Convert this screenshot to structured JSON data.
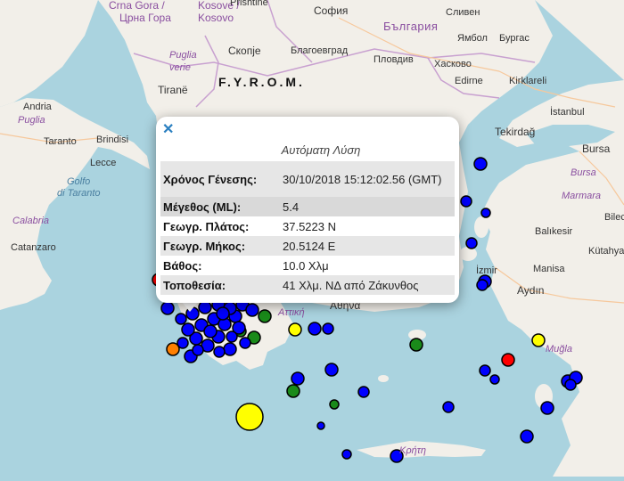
{
  "map_labels": {
    "crna_gora": "Crna Gora /",
    "crna_gora_cyr": "Црна Гора",
    "kosove": "Kosove /",
    "kosovo": "Kosovo",
    "sofia": "София",
    "bulgaria": "България",
    "sliven": "Сливен",
    "yambol": "Ямбол",
    "burgas": "Бургас",
    "pristina": "Prishtinë",
    "skopje": "Скопје",
    "blagoevgrad": "Благоевград",
    "plovdiv": "Пловдив",
    "haskovo": "Хасково",
    "tirane": "Tiranë",
    "fyrom": "F.Y.R.O.M.",
    "edirne": "Edirne",
    "kirklareli": "Kirklareli",
    "puglia_verie": "Puglia",
    "verie": "verie",
    "andria": "Andria",
    "puglia": "Puglia",
    "taranto": "Taranto",
    "brindisi": "Brindisi",
    "lecce": "Lecce",
    "golfo": "Golfo",
    "di_taranto": "di Taranto",
    "calabria": "Calabria",
    "catanzaro": "Catanzaro",
    "istanbul": "İstanbul",
    "tekirdag": "Tekirdağ",
    "bursa": "Bursa",
    "bilecik": "Bilecik",
    "marmara": "Marmara",
    "balikesir": "Balıkesir",
    "kutahya": "Kütahya",
    "izmir": "İzmir",
    "manisa": "Manisa",
    "aydin": "Aydın",
    "mugla": "Muğla",
    "athina": "Αθήνα",
    "attiki": "Αττική",
    "krete": "Κρήτη"
  },
  "popup": {
    "close_icon": "close-icon",
    "title": "Αυτόματη Λύση",
    "rows": [
      {
        "key": "Χρόνος Γένεσης:",
        "value": "30/10/2018 15:12:02.56 (GMT)"
      },
      {
        "key": "Μέγεθος (ML):",
        "value": "5.4"
      },
      {
        "key": "Γεωγρ. Πλάτος:",
        "value": "37.5223 N"
      },
      {
        "key": "Γεωγρ. Μήκος:",
        "value": "20.5124 E"
      },
      {
        "key": "Βάθος:",
        "value": "10.0 Χλμ"
      },
      {
        "key": "Τοποθεσία:",
        "value": "41 Χλμ. ΝΔ από Ζάκυνθος"
      }
    ]
  },
  "colors": {
    "sea": "#aad3df",
    "land": "#f2efe9",
    "marker_blue": "#0000ff",
    "marker_green": "#1a8a1a",
    "marker_yellow": "#ffff00",
    "marker_orange": "#ff7f00",
    "marker_red": "#ff0000",
    "link_blue": "#2a7fc0"
  }
}
